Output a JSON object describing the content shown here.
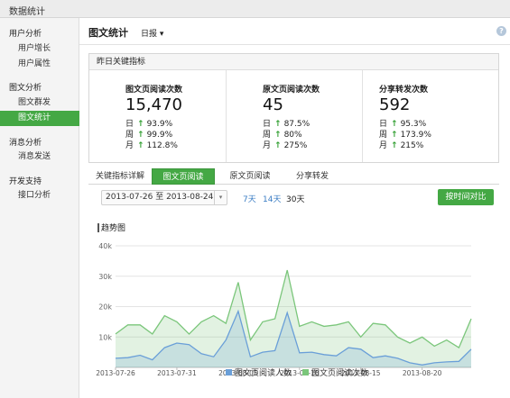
{
  "app": {
    "title": "数据统计"
  },
  "sidebar": {
    "sections": [
      {
        "label": "用户分析",
        "items": [
          {
            "label": "用户增长"
          },
          {
            "label": "用户属性"
          }
        ]
      },
      {
        "label": "图文分析",
        "items": [
          {
            "label": "图文群发"
          },
          {
            "label": "图文统计",
            "active": true
          }
        ]
      },
      {
        "label": "消息分析",
        "items": [
          {
            "label": "消息发送"
          }
        ]
      },
      {
        "label": "开发支持",
        "items": [
          {
            "label": "接口分析"
          }
        ]
      }
    ]
  },
  "header": {
    "title": "图文统计",
    "period": "日报",
    "period_caret": "▾",
    "help_icon": "?"
  },
  "kpi": {
    "title": "昨日关键指标",
    "cards": [
      {
        "label": "图文页阅读次数",
        "value": "15,470",
        "rows": [
          {
            "k": "日",
            "v": "93.9%"
          },
          {
            "k": "周",
            "v": "99.9%"
          },
          {
            "k": "月",
            "v": "112.8%"
          }
        ]
      },
      {
        "label": "原文页阅读次数",
        "value": "45",
        "rows": [
          {
            "k": "日",
            "v": "87.5%"
          },
          {
            "k": "周",
            "v": "80%"
          },
          {
            "k": "月",
            "v": "275%"
          }
        ]
      },
      {
        "label": "分享转发次数",
        "value": "592",
        "rows": [
          {
            "k": "日",
            "v": "95.3%"
          },
          {
            "k": "周",
            "v": "173.9%"
          },
          {
            "k": "月",
            "v": "215%"
          }
        ]
      }
    ],
    "trend_icon": "arrow-up-icon",
    "up_color": "#2f9e2f"
  },
  "tabs": {
    "label": "关键指标详解",
    "items": [
      {
        "label": "图文页阅读",
        "active": true
      },
      {
        "label": "原文页阅读"
      },
      {
        "label": "分享转发"
      }
    ]
  },
  "filters": {
    "date_from": "2013-07-26",
    "date_sep": "至",
    "date_to": "2013-08-24",
    "caret": "▾",
    "quick": [
      "7天",
      "14天",
      "30天"
    ],
    "compare_button": "按时间对比"
  },
  "chart_title": "趋势图",
  "colors": {
    "accent": "#44a844",
    "series_people": "#6a9fd8",
    "series_times": "#7bc67b"
  },
  "chart_data": {
    "type": "area",
    "x": [
      "2013-07-26",
      "2013-07-27",
      "2013-07-28",
      "2013-07-29",
      "2013-07-30",
      "2013-07-31",
      "2013-08-01",
      "2013-08-02",
      "2013-08-03",
      "2013-08-04",
      "2013-08-05",
      "2013-08-06",
      "2013-08-07",
      "2013-08-08",
      "2013-08-09",
      "2013-08-10",
      "2013-08-11",
      "2013-08-12",
      "2013-08-13",
      "2013-08-14",
      "2013-08-15",
      "2013-08-16",
      "2013-08-17",
      "2013-08-18",
      "2013-08-19",
      "2013-08-20",
      "2013-08-21",
      "2013-08-22",
      "2013-08-23",
      "2013-08-24"
    ],
    "xticks": [
      "2013-07-26",
      "2013-07-31",
      "2013-08-05",
      "2013-08-10",
      "2013-08-15",
      "2013-08-20"
    ],
    "ylim": [
      0,
      40000
    ],
    "yticks": [
      10000,
      20000,
      30000,
      40000
    ],
    "ytick_labels": [
      "10k",
      "20k",
      "30k",
      "40k"
    ],
    "grid": true,
    "legend": "bottom-center",
    "series": [
      {
        "name": "图文页阅读人数",
        "color": "#6a9fd8",
        "values": [
          3000,
          3200,
          4000,
          2500,
          6500,
          8000,
          7500,
          4500,
          3500,
          9000,
          18500,
          3500,
          5000,
          5500,
          18000,
          4800,
          5000,
          4200,
          3800,
          6500,
          6000,
          3200,
          3800,
          3000,
          1500,
          800,
          1500,
          1800,
          2000,
          6000
        ]
      },
      {
        "name": "图文页阅读次数",
        "color": "#7bc67b",
        "values": [
          11000,
          14000,
          14000,
          11000,
          17000,
          15000,
          11000,
          15000,
          17000,
          14500,
          28000,
          9000,
          15000,
          16000,
          32000,
          13500,
          15000,
          13500,
          14000,
          15000,
          10000,
          14500,
          14000,
          10000,
          8000,
          10000,
          7000,
          9000,
          6500,
          16000
        ]
      }
    ]
  }
}
